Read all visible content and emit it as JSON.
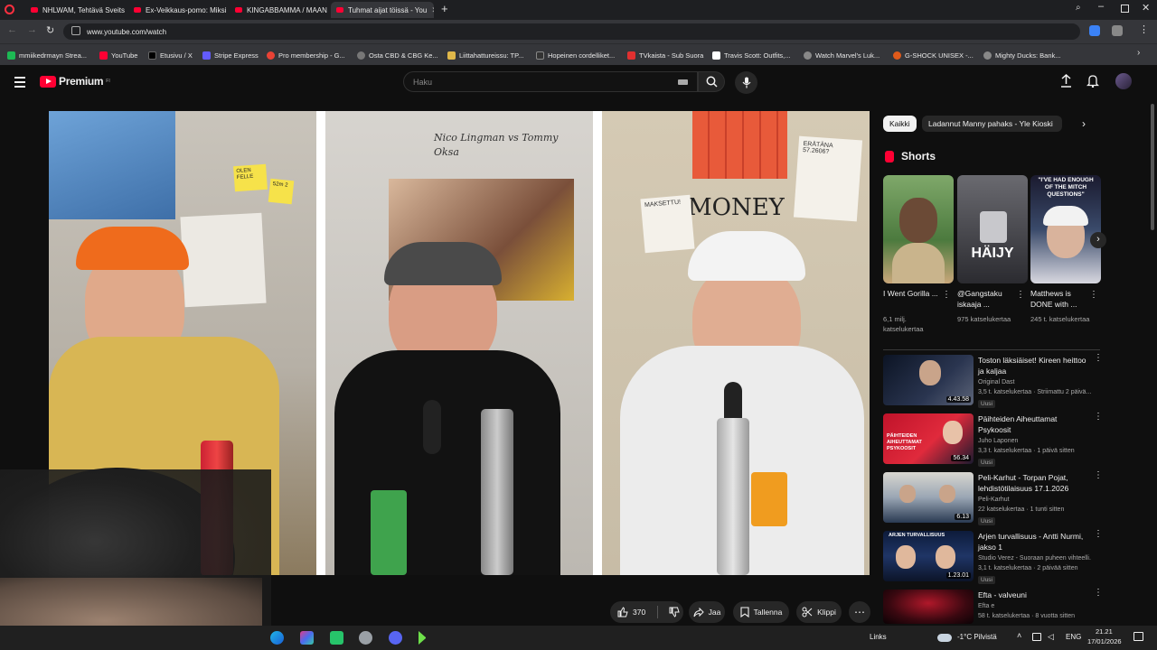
{
  "browser": {
    "tabs": [
      {
        "label": "NHLWAM, Tehtävä Sveits"
      },
      {
        "label": "Ex-Veikkaus-pomo: Miksi"
      },
      {
        "label": "KINGABBAMMA / MAAN"
      },
      {
        "label": "Tuhmat aijat töissä - You"
      }
    ],
    "url": "www.youtube.com/watch",
    "bookmarks": [
      {
        "label": "mmiikedrmayn Strea...",
        "color": "#1db954"
      },
      {
        "label": "YouTube",
        "color": "#ff0033"
      },
      {
        "label": "Etusivu / X",
        "color": "#000000"
      },
      {
        "label": "Stripe Express",
        "color": "#635bff"
      },
      {
        "label": "Pro membership - G...",
        "color": "#e94235"
      },
      {
        "label": "Osta CBD & CBG Ke...",
        "color": "#777777"
      },
      {
        "label": "Liittahattureissu: TP...",
        "color": "#e0b84a"
      },
      {
        "label": "Hopeinen cordelliket...",
        "color": "#333333"
      },
      {
        "label": "TVkaista - Sub Suora",
        "color": "#e03030"
      },
      {
        "label": "Travis Scott: Outfits,...",
        "color": "#ffffff"
      },
      {
        "label": "Watch Marvel's Luk...",
        "color": "#888888"
      },
      {
        "label": "G-SHOCK UNISEX -...",
        "color": "#e05a1a"
      },
      {
        "label": "Mighty Ducks: Bank...",
        "color": "#888888"
      }
    ]
  },
  "youtube": {
    "logo": "Premium",
    "logo_sup": "FI",
    "search_placeholder": "Haku",
    "actions": {
      "likes": "370",
      "share": "Jaa",
      "save": "Tallenna",
      "clip": "Klippi"
    },
    "chips": [
      "Kaikki",
      "Ladannut Manny pahaks - Yle Kioski"
    ],
    "shorts_heading": "Shorts",
    "shorts": [
      {
        "title": "I Went Gorilla ...",
        "views": "6,1 milj. katselukertaa"
      },
      {
        "title": "@Gangstaku iskaaja ...",
        "views": "975 katselukertaa"
      },
      {
        "title": "Matthews is DONE with ...",
        "views": "245 t. katselukertaa"
      }
    ],
    "short_overlays": {
      "haijy": "HÄIJY",
      "matthews": "\"I'VE HAD ENOUGH OF THE MITCH QUESTIONS\""
    },
    "recommended": [
      {
        "title": "Toston läksiäiset! Kireen heittoo ja kaljaa",
        "channel": "Original Dast",
        "meta": "3,5 t. katselukertaa · Striimattu 2 päivä...",
        "duration": "4.43.58",
        "new": "Uusi"
      },
      {
        "title": "Päihteiden Aiheuttamat Psykoosit",
        "channel": "Juho Laponen",
        "meta": "3,3 t. katselukertaa · 1 päivä sitten",
        "duration": "56.34",
        "new": "Uusi"
      },
      {
        "title": "Peli-Karhut - Torpan Pojat, lehdistötilaisuus 17.1.2026",
        "channel": "Peli-Karhut",
        "meta": "22 katselukertaa · 1 tunti sitten",
        "duration": "6.13",
        "new": "Uusi"
      },
      {
        "title": "Arjen turvallisuus - Antti Nurmi, jakso 1",
        "channel": "Studio Verez - Suoraan puheen vihteelli...",
        "meta": "3,1 t. katselukertaa · 2 päivää sitten",
        "duration": "1.23.01",
        "new": "Uusi"
      },
      {
        "title": "Efta - valveuni",
        "channel": "Efta e",
        "meta": "58 t. katselukertaa · 8 vuotta sitten",
        "duration": "",
        "new": ""
      }
    ]
  },
  "video_text": {
    "panel2_caption": "Nico Lingman vs Tommy Oksa",
    "panel3_money": "MONEY",
    "panel3_note1": "MAKSETTU!",
    "panel3_note2": "ERÄTÄNA 57.2606?",
    "panel1_note1": "OLEN FELLE",
    "panel1_note2": "52m 2"
  },
  "taskbar": {
    "links": "Links",
    "weather": "-1°C  Pilvistä",
    "lang": "ENG",
    "time": "21.21",
    "date": "17/01/2026"
  }
}
